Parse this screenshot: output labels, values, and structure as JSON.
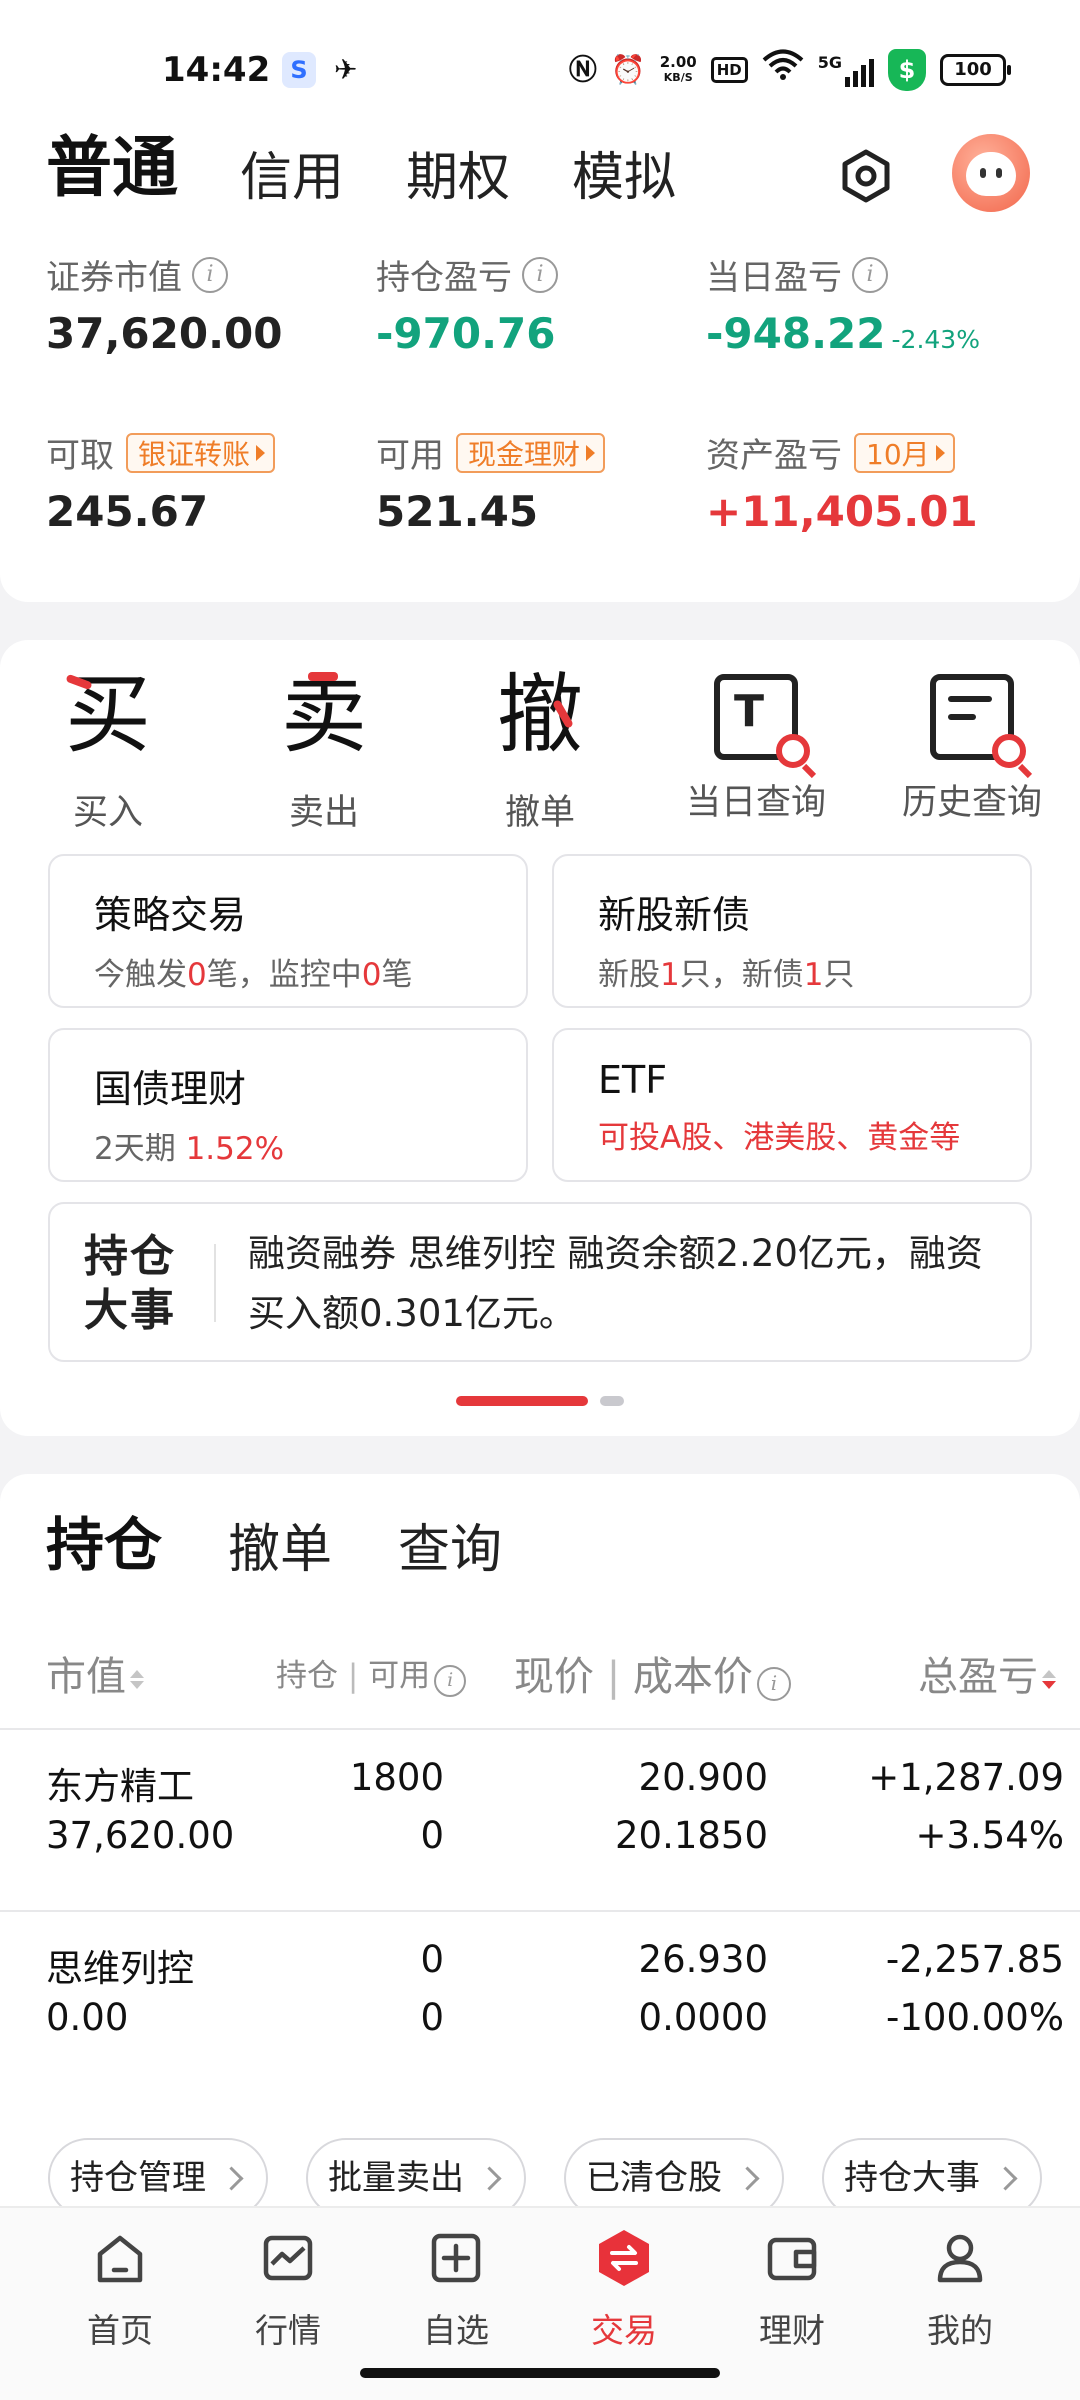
{
  "status_bar": {
    "time": "14:42",
    "app_icon_1": "S",
    "speed": "2.00",
    "speed_unit": "KB/S",
    "hd": "HD",
    "net": "5G",
    "shield": "$",
    "battery": "100",
    "icons": [
      "nfc-icon",
      "alarm-icon",
      "wifi-icon",
      "signal-icon",
      "security-shield-icon",
      "battery-icon"
    ]
  },
  "account_tabs": [
    {
      "label": "普通",
      "active": true
    },
    {
      "label": "信用",
      "active": false
    },
    {
      "label": "期权",
      "active": false
    },
    {
      "label": "模拟",
      "active": false
    }
  ],
  "metrics": {
    "market_value": {
      "label": "证券市值",
      "value": "37,620.00"
    },
    "position_pnl": {
      "label": "持仓盈亏",
      "value": "-970.76"
    },
    "daily_pnl": {
      "label": "当日盈亏",
      "value": "-948.22",
      "pct": "-2.43%"
    },
    "withdrawable": {
      "label": "可取",
      "value": "245.67",
      "chip": "银证转账"
    },
    "available": {
      "label": "可用",
      "value": "521.45",
      "chip": "现金理财"
    },
    "asset_pnl": {
      "label": "资产盈亏",
      "value": "+11,405.01",
      "chip": "10月"
    }
  },
  "actions": [
    {
      "glyph": "买",
      "label": "买入"
    },
    {
      "glyph": "卖",
      "label": "卖出"
    },
    {
      "glyph": "撤",
      "label": "撤单"
    },
    {
      "glyph": "T",
      "label": "当日查询"
    },
    {
      "glyph": "",
      "label": "历史查询"
    }
  ],
  "tiles": {
    "strategy": {
      "title": "策略交易",
      "sub_a": "今触发",
      "sub_b": "0",
      "sub_c": "笔，监控中",
      "sub_d": "0",
      "sub_e": "笔"
    },
    "ipo": {
      "title": "新股新债",
      "sub_a": "新股",
      "sub_b": "1",
      "sub_c": "只，新债",
      "sub_d": "1",
      "sub_e": "只"
    },
    "bond": {
      "title": "国债理财",
      "sub_a": "2天期 ",
      "sub_b": "1.52%"
    },
    "etf": {
      "title": "ETF",
      "sub": "可投A股、港美股、黄金等"
    }
  },
  "news": {
    "badge_line1": "持仓",
    "badge_line2": "大事",
    "text": "融资融券 思维列控 融资余额2.20亿元，融资买入额0.301亿元。"
  },
  "holdings_tabs": [
    {
      "label": "持仓",
      "active": true
    },
    {
      "label": "撤单",
      "active": false
    },
    {
      "label": "查询",
      "active": false
    }
  ],
  "holdings_header": {
    "market_value": "市值",
    "position": "持仓",
    "available": "可用",
    "price": "现价",
    "cost": "成本价",
    "total_pnl": "总盈亏"
  },
  "holdings": [
    {
      "name": "东方精工",
      "market_value": "37,620.00",
      "position": "1800",
      "available": "0",
      "price": "20.900",
      "cost": "20.1850",
      "pnl": "+1,287.09",
      "pnl_pct": "+3.54%",
      "direction": "up"
    },
    {
      "name": "思维列控",
      "market_value": "0.00",
      "position": "0",
      "available": "0",
      "price": "26.930",
      "cost": "0.0000",
      "pnl": "-2,257.85",
      "pnl_pct": "-100.00%",
      "direction": "down"
    }
  ],
  "bottom_buttons": [
    "持仓管理",
    "批量卖出",
    "已清仓股",
    "持仓大事"
  ],
  "bottom_nav": [
    {
      "label": "首页",
      "icon": "home-icon",
      "active": false
    },
    {
      "label": "行情",
      "icon": "chart-icon",
      "active": false
    },
    {
      "label": "自选",
      "icon": "add-square-icon",
      "active": false
    },
    {
      "label": "交易",
      "icon": "trade-exchange-icon",
      "active": true
    },
    {
      "label": "理财",
      "icon": "wallet-icon",
      "active": false
    },
    {
      "label": "我的",
      "icon": "profile-icon",
      "active": false
    }
  ],
  "colors": {
    "up": "#e5383b",
    "down": "#12a37d",
    "accent": "#e5383b",
    "chip": "#ef7d28"
  }
}
